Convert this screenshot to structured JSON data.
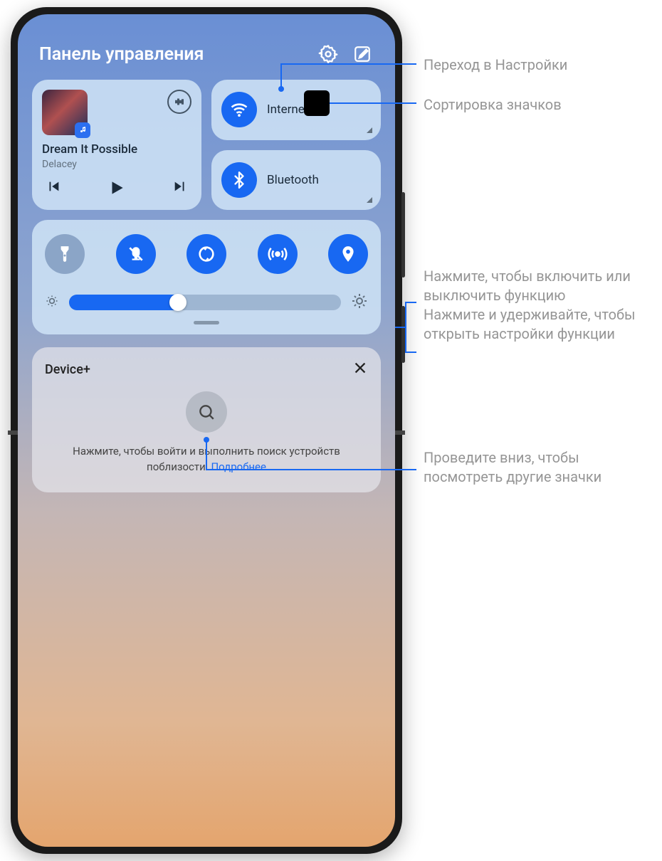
{
  "header": {
    "title": "Панель управления"
  },
  "media": {
    "song": "Dream It Possible",
    "artist": "Delacey"
  },
  "toggles": {
    "wifi": "Internet",
    "bluetooth": "Bluetooth"
  },
  "device": {
    "title": "Device+",
    "hint_prefix": "Нажмите, чтобы войти и выполнить поиск устройств поблизости. ",
    "hint_link": "Подробнее"
  },
  "annotations": {
    "settings": "Переход в Настройки",
    "sort": "Сортировка значков",
    "toggle_hint": "Нажмите, чтобы включить или выключить функцию\nНажмите и удерживайте, чтобы открыть настройки функции",
    "swipe_hint": "Проведите вниз, чтобы посмотреть другие значки"
  }
}
